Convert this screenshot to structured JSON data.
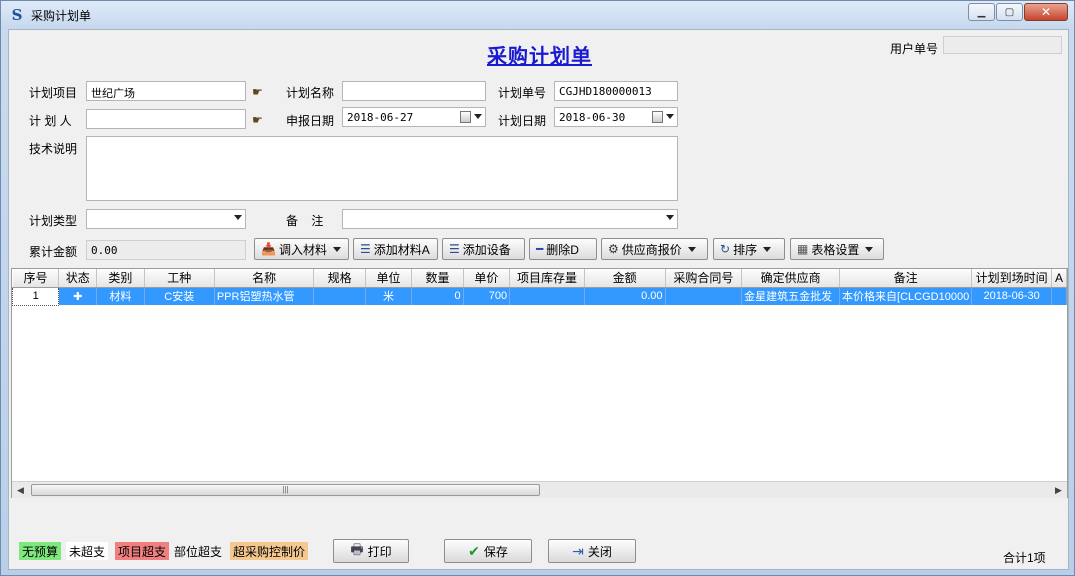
{
  "window": {
    "title": "采购计划单",
    "min_label": "▁",
    "max_label": "▢",
    "close_label": "✕"
  },
  "header": {
    "heading": "采购计划单",
    "user_no_label": "用户单号",
    "user_no_value": ""
  },
  "form": {
    "project_label": "计划项目",
    "project_value": "世纪广场",
    "plan_name_label": "计划名称",
    "plan_name_value": "",
    "plan_no_label": "计划单号",
    "plan_no_value": "CGJHD180000013",
    "planner_label": "计 划 人",
    "planner_value": "",
    "report_date_label": "申报日期",
    "report_date_value": "2018-06-27",
    "plan_date_label": "计划日期",
    "plan_date_value": "2018-06-30",
    "tech_label": "技术说明",
    "tech_value": "",
    "plan_type_label": "计划类型",
    "plan_type_value": "",
    "remark_label": "备    注",
    "remark_value": "",
    "total_label": "累计金额",
    "total_value": "0.00"
  },
  "toolbar": {
    "import_material": "调入材料",
    "add_material": "添加材料A",
    "add_equipment": "添加设备",
    "delete": "删除D",
    "supplier_quote": "供应商报价",
    "sort": "排序",
    "table_settings": "表格设置"
  },
  "table": {
    "columns": [
      "序号",
      "状态",
      "类别",
      "工种",
      "名称",
      "规格",
      "单位",
      "数量",
      "单价",
      "项目库存量",
      "金额",
      "采购合同号",
      "确定供应商",
      "备注",
      "计划到场时间",
      "A"
    ],
    "rows": [
      {
        "seq": "1",
        "status": "✚",
        "category": "材料",
        "trade": "C安装",
        "name": "PPR铝塑热水管",
        "spec": "",
        "unit": "米",
        "qty": "0",
        "price": "700",
        "stock": "",
        "amount": "0.00",
        "contract": "",
        "supplier": "金星建筑五金批发",
        "remark": "本价格来自[CLCGD10000",
        "arrival": "2018-06-30",
        "extra": ""
      }
    ]
  },
  "scrollbar": {
    "left": "◀",
    "right": "▶",
    "grip": "|||"
  },
  "legend": [
    {
      "label": "无预算",
      "color": "#7ee87e"
    },
    {
      "label": "未超支",
      "color": "#ffffff"
    },
    {
      "label": "项目超支",
      "color": "#f08080"
    },
    {
      "label": "部位超支",
      "color": "#f0f0f0"
    },
    {
      "label": "超采购控制价",
      "color": "#f5c890"
    }
  ],
  "footer": {
    "print": "打印",
    "save": "保存",
    "close": "关闭",
    "count": "合计1项"
  }
}
